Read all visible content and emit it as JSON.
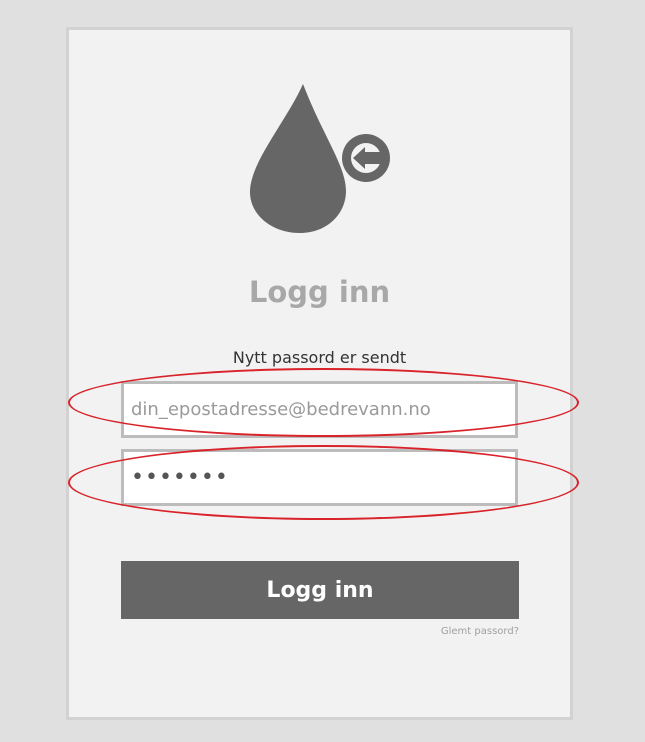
{
  "login": {
    "title": "Logg inn",
    "status_message": "Nytt passord er sendt",
    "email": {
      "placeholder": "din_epostadresse@bedrevann.no",
      "value": ""
    },
    "password": {
      "value": "•••••••"
    },
    "submit_label": "Logg inn",
    "forgot_password_label": "Glemt passord?"
  },
  "colors": {
    "background": "#e0e0e0",
    "card": "#f2f2f2",
    "logo": "#666666",
    "button": "#666666",
    "title": "#a8a8a8",
    "annotation": "#d8232a"
  },
  "icons": [
    "water-drop-icon",
    "login-arrow-icon"
  ]
}
